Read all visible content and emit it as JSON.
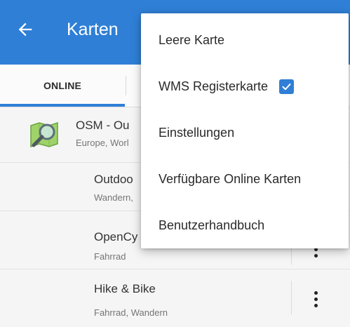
{
  "appbar": {
    "title": "Karten",
    "back_icon": "arrow-left-icon"
  },
  "tabs": {
    "online_label": "ONLINE"
  },
  "list": {
    "items": [
      {
        "title": "OSM - Ou",
        "subtitle": "Europe, Worl",
        "icon": "magnifier-map-icon"
      },
      {
        "title": "Outdoo",
        "subtitle": "Wandern,"
      },
      {
        "title": "OpenCy",
        "subtitle": "Fahrrad"
      },
      {
        "title": "Hike & Bike",
        "subtitle": "Fahrrad, Wandern"
      }
    ]
  },
  "menu": {
    "items": [
      {
        "label": "Leere Karte"
      },
      {
        "label": "WMS Registerkarte",
        "checked": true
      },
      {
        "label": "Einstellungen"
      },
      {
        "label": "Verfügbare Online Karten"
      },
      {
        "label": "Benutzerhandbuch"
      }
    ]
  },
  "colors": {
    "primary": "#2f7fd6",
    "background": "#f5f5f5"
  }
}
